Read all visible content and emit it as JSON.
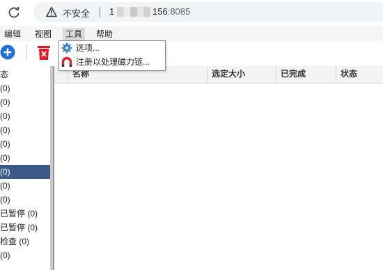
{
  "browser": {
    "insecure_label": "不安全",
    "url_prefix": "1",
    "url_host_suffix": "156",
    "url_port": ":8085"
  },
  "menubar": {
    "items": [
      {
        "label": "编辑"
      },
      {
        "label": "视图"
      },
      {
        "label": "工具"
      },
      {
        "label": "帮助"
      }
    ]
  },
  "tools_menu": {
    "items": [
      {
        "label": "选项...",
        "icon": "gear-icon"
      },
      {
        "label": "注册以处理磁力链...",
        "icon": "magnet-icon"
      }
    ]
  },
  "toolbar": {
    "add_icon": "add-icon",
    "delete_icon": "delete-icon",
    "colors": {
      "add": "#1e6fd9",
      "delete": "#e01b24"
    }
  },
  "sidebar": {
    "header": "态",
    "items": [
      {
        "label": "(0)"
      },
      {
        "label": "(0)"
      },
      {
        "label": "(0)"
      },
      {
        "label": "(0)"
      },
      {
        "label": "(0)"
      },
      {
        "label": "(0)"
      },
      {
        "label": "(0)",
        "selected": true
      },
      {
        "label": "(0)"
      },
      {
        "label": "(0)"
      },
      {
        "label": "已暂停 (0)"
      },
      {
        "label": "已暂停 (0)"
      },
      {
        "label": "检查 (0)"
      },
      {
        "label": "(0)"
      }
    ],
    "selected_color": "#3b5a8a"
  },
  "table": {
    "columns": [
      {
        "label": "名称"
      },
      {
        "label": "选定大小"
      },
      {
        "label": "已完成"
      },
      {
        "label": "状态"
      }
    ],
    "rows": []
  }
}
